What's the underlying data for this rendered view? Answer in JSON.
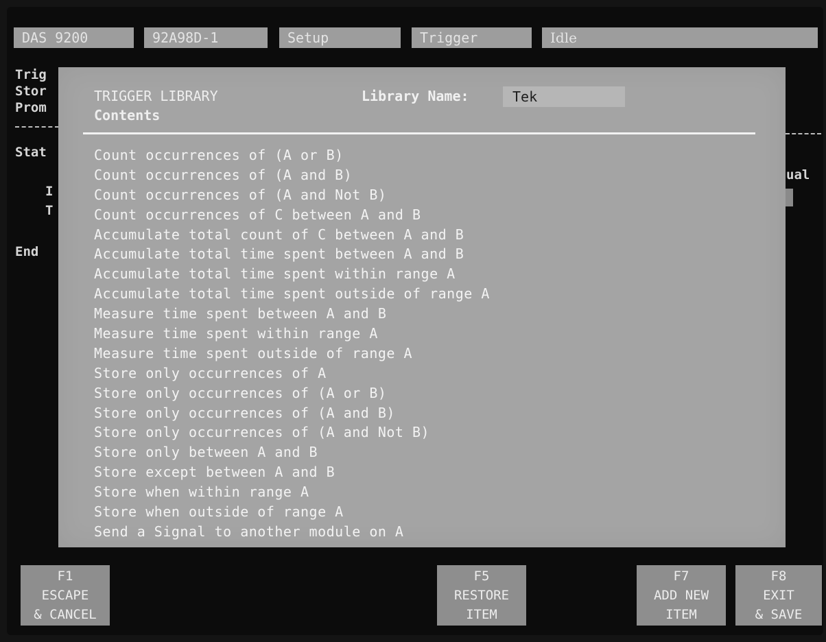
{
  "status_bar": {
    "instrument": "DAS 9200",
    "module": "92A98D-1",
    "menu": "Setup",
    "submenu": "Trigger",
    "state": "Idle"
  },
  "background_screen": {
    "line1": "Trig",
    "line2": "Stor",
    "line3": "Prom",
    "stat": "Stat",
    "i": "I",
    "t": "T",
    "end": "End",
    "right_label": "ual"
  },
  "dialog": {
    "title": "TRIGGER LIBRARY",
    "subtitle": "Contents",
    "library_name_label": "Library Name:",
    "library_name_value": "Tek",
    "items": [
      "Count occurrences of (A or B)",
      "Count occurrences of (A and B)",
      "Count occurrences of (A and Not B)",
      "Count occurrences of C between A and B",
      "Accumulate total count of C between A and B",
      "Accumulate total time spent between A and B",
      "Accumulate total time spent within range A",
      "Accumulate total time spent outside of range A",
      "Measure time spent between A and B",
      "Measure time spent within range A",
      "Measure time spent outside of range A",
      "Store only occurrences of A",
      "Store only occurrences of (A or B)",
      "Store only occurrences of (A and B)",
      "Store only occurrences of (A and Not B)",
      "Store only between A and B",
      "Store except between A and B",
      "Store when within range A",
      "Store when outside of range A",
      "Send a Signal to another module on A"
    ]
  },
  "function_keys": {
    "f1": {
      "key": "F1",
      "line1": "ESCAPE",
      "line2": "& CANCEL"
    },
    "f5": {
      "key": "F5",
      "line1": "RESTORE",
      "line2": "ITEM"
    },
    "f7": {
      "key": "F7",
      "line1": "ADD NEW",
      "line2": "ITEM"
    },
    "f8": {
      "key": "F8",
      "line1": "EXIT",
      "line2": "& SAVE"
    }
  }
}
